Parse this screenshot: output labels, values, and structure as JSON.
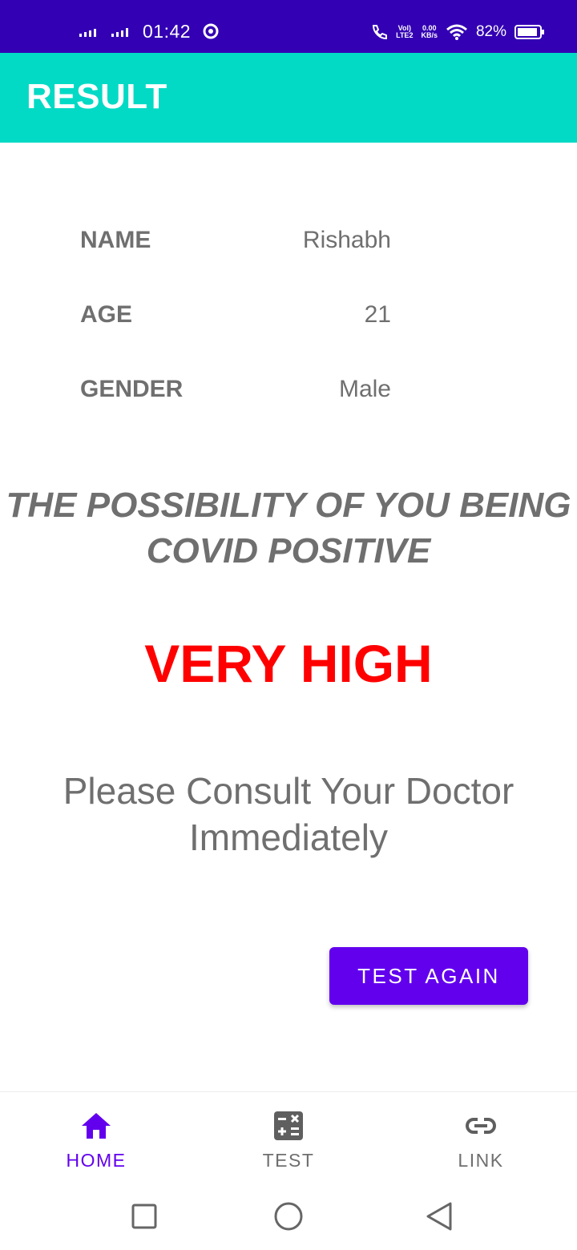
{
  "status_bar": {
    "time": "01:42",
    "battery": "82%",
    "lte_label_top": "Vol)",
    "lte_label_bottom": "LTE2",
    "speed_top": "0.00",
    "speed_bottom": "KB/s"
  },
  "app_bar": {
    "title": "RESULT"
  },
  "info": {
    "name_label": "NAME",
    "name_value": "Rishabh",
    "age_label": "AGE",
    "age_value": "21",
    "gender_label": "GENDER",
    "gender_value": "Male"
  },
  "possibility": {
    "line1": "THE POSSIBILITY OF YOU BEING",
    "line2": "COVID POSITIVE"
  },
  "result": {
    "level": "VERY HIGH"
  },
  "advice": {
    "line1": "Please Consult Your Doctor",
    "line2": "Immediately"
  },
  "actions": {
    "test_again_label": "TEST AGAIN"
  },
  "bottom_nav": {
    "items": [
      {
        "label": "HOME",
        "icon": "home-icon",
        "active": true
      },
      {
        "label": "TEST",
        "icon": "calculator-icon",
        "active": false
      },
      {
        "label": "LINK",
        "icon": "link-icon",
        "active": false
      }
    ]
  },
  "colors": {
    "status_bar": "#3300b3",
    "app_bar": "#03dac5",
    "primary": "#6200ee",
    "result_red": "#ff0000",
    "text_gray": "#6f6f6f"
  }
}
